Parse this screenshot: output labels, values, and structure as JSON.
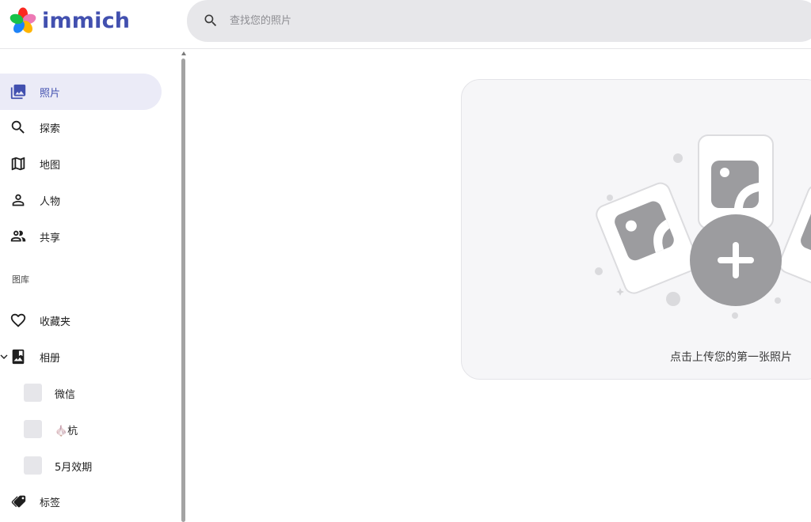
{
  "app": {
    "name": "immich"
  },
  "search": {
    "placeholder": "查找您的照片"
  },
  "sidebar": {
    "items": [
      {
        "label": "照片",
        "icon": "photos-icon"
      },
      {
        "label": "探索",
        "icon": "search-icon"
      },
      {
        "label": "地图",
        "icon": "map-icon"
      },
      {
        "label": "人物",
        "icon": "person-icon"
      },
      {
        "label": "共享",
        "icon": "account-multiple-icon"
      }
    ],
    "library_section": "图库",
    "library_items": [
      {
        "label": "收藏夹",
        "icon": "heart-icon"
      },
      {
        "label": "相册",
        "icon": "album-icon"
      }
    ],
    "albums": [
      {
        "label": "微信"
      },
      {
        "label": "🧄杭"
      },
      {
        "label": "5月效期"
      }
    ],
    "tags": {
      "label": "标签",
      "icon": "tag-icon"
    }
  },
  "main": {
    "empty_message": "点击上传您的第一张照片"
  },
  "colors": {
    "accent": "#4250af",
    "active_bg": "#ebebf7",
    "search_bg": "#e7e7ea",
    "card_bg": "#f6f6f8"
  }
}
